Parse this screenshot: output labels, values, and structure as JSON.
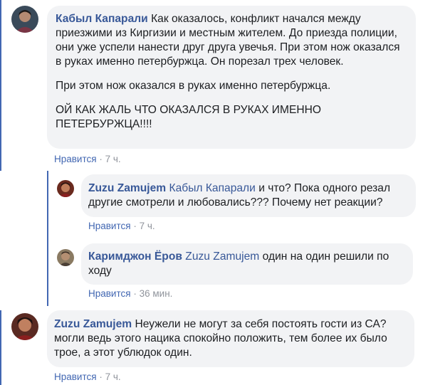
{
  "comments": [
    {
      "author": "Кабыл Капарали",
      "paragraphs": [
        "Как оказалось, конфликт начался между приезжими из Киргизии и местным жителем. До приезда полиции, они уже успели нанести друг друга увечья. При этом нож оказался в руках именно петербуржца. Он порезал трех человек.",
        "При этом нож оказался в руках именно петербуржца.",
        "ОЙ КАК ЖАЛЬ ЧТО ОКАЗАЛСЯ В РУКАХ ИМЕННО ПЕТЕРБУРЖЦА!!!!"
      ],
      "like_label": "Нравится",
      "separator": "·",
      "time": "7 ч."
    },
    {
      "author": "Zuzu Zamujem",
      "mention": "Кабыл Капарали",
      "text": "и что? Пока одного резал другие смотрели и любовались??? Почему нет реакции?",
      "like_label": "Нравится",
      "separator": "·",
      "time": "7 ч."
    },
    {
      "author": "Каримджон Ёров",
      "mention": "Zuzu Zamujem",
      "text": "один на один решили по ходу",
      "like_label": "Нравится",
      "separator": "·",
      "time": "36 мин."
    },
    {
      "author": "Zuzu Zamujem",
      "text": "Неужели не могут за себя постоять гости из СА? могли ведь этого нацика спокойно положить, тем более их было трое, а этот ублюдок один.",
      "like_label": "Нравится",
      "separator": "·",
      "time": "7 ч."
    }
  ],
  "colors": {
    "author": "#385898",
    "bubble": "#f2f3f5",
    "meta": "#90949c",
    "thread_line": "#4267b2"
  },
  "icons": [
    "avatar-kabyl",
    "avatar-zuzu",
    "avatar-karimjon"
  ]
}
